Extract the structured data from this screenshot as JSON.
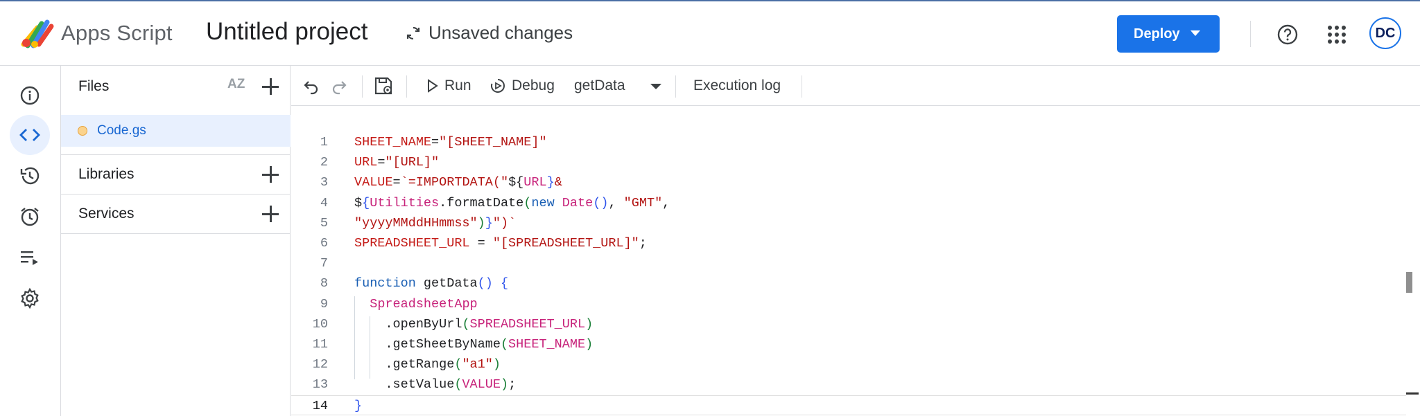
{
  "header": {
    "brand": "Apps Script",
    "project_title": "Untitled project",
    "status": "Unsaved changes",
    "deploy_label": "Deploy",
    "avatar_initials": "DC"
  },
  "rail": {
    "items": [
      {
        "icon": "info-icon",
        "label": "Overview"
      },
      {
        "icon": "code-icon",
        "label": "Editor",
        "active": true
      },
      {
        "icon": "history-icon",
        "label": "Project History"
      },
      {
        "icon": "alarm-icon",
        "label": "Triggers"
      },
      {
        "icon": "executions-icon",
        "label": "Executions"
      },
      {
        "icon": "gear-icon",
        "label": "Project Settings"
      }
    ]
  },
  "files_panel": {
    "title": "Files",
    "sort_label": "AZ",
    "files": [
      {
        "name": "Code.gs"
      }
    ],
    "sections": [
      {
        "label": "Libraries"
      },
      {
        "label": "Services"
      }
    ]
  },
  "toolbar": {
    "run_label": "Run",
    "debug_label": "Debug",
    "function_select": "getData",
    "execution_log_label": "Execution log"
  },
  "editor": {
    "current_line": 14,
    "lines": [
      {
        "n": "1",
        "tokens": [
          {
            "t": "SHEET_NAME",
            "c": "c-var"
          },
          {
            "t": "=",
            "c": "c-plain"
          },
          {
            "t": "\"[SHEET_NAME]\"",
            "c": "c-str"
          }
        ]
      },
      {
        "n": "2",
        "tokens": [
          {
            "t": "URL",
            "c": "c-var"
          },
          {
            "t": "=",
            "c": "c-plain"
          },
          {
            "t": "\"[URL]\"",
            "c": "c-str"
          }
        ]
      },
      {
        "n": "3",
        "tokens": [
          {
            "t": "VALUE",
            "c": "c-var"
          },
          {
            "t": "=",
            "c": "c-plain"
          },
          {
            "t": "`=IMPORTDATA(\"",
            "c": "c-str"
          },
          {
            "t": "${",
            "c": "c-plain"
          },
          {
            "t": "URL",
            "c": "c-pink"
          },
          {
            "t": "}",
            "c": "c-br2"
          },
          {
            "t": "&",
            "c": "c-str"
          }
        ]
      },
      {
        "n": "4",
        "tokens": [
          {
            "t": "$",
            "c": "c-plain"
          },
          {
            "t": "{",
            "c": "c-br2"
          },
          {
            "t": "Utilities",
            "c": "c-pink"
          },
          {
            "t": ".formatDate",
            "c": "c-plain"
          },
          {
            "t": "(",
            "c": "c-br"
          },
          {
            "t": "new ",
            "c": "c-kw"
          },
          {
            "t": "Date",
            "c": "c-pink"
          },
          {
            "t": "()",
            "c": "c-br2"
          },
          {
            "t": ", ",
            "c": "c-plain"
          },
          {
            "t": "\"GMT\"",
            "c": "c-str"
          },
          {
            "t": ",",
            "c": "c-plain"
          }
        ]
      },
      {
        "n": "5",
        "tokens": [
          {
            "t": "\"yyyyMMddHHmmss\"",
            "c": "c-str"
          },
          {
            "t": ")",
            "c": "c-br"
          },
          {
            "t": "}",
            "c": "c-br2"
          },
          {
            "t": "\")`",
            "c": "c-str"
          }
        ]
      },
      {
        "n": "6",
        "tokens": [
          {
            "t": "SPREADSHEET_URL",
            "c": "c-var"
          },
          {
            "t": " = ",
            "c": "c-plain"
          },
          {
            "t": "\"[SPREADSHEET_URL]\"",
            "c": "c-str"
          },
          {
            "t": ";",
            "c": "c-plain"
          }
        ]
      },
      {
        "n": "7",
        "tokens": []
      },
      {
        "n": "8",
        "tokens": [
          {
            "t": "function ",
            "c": "c-kw"
          },
          {
            "t": "getData",
            "c": "c-plain"
          },
          {
            "t": "() {",
            "c": "c-br2"
          }
        ]
      },
      {
        "n": "9",
        "tokens": [
          {
            "t": "  ",
            "c": "c-plain"
          },
          {
            "t": "SpreadsheetApp",
            "c": "c-pink"
          }
        ]
      },
      {
        "n": "10",
        "tokens": [
          {
            "t": "    .openByUrl",
            "c": "c-plain"
          },
          {
            "t": "(",
            "c": "c-br"
          },
          {
            "t": "SPREADSHEET_URL",
            "c": "c-pink"
          },
          {
            "t": ")",
            "c": "c-br"
          }
        ]
      },
      {
        "n": "11",
        "tokens": [
          {
            "t": "    .getSheetByName",
            "c": "c-plain"
          },
          {
            "t": "(",
            "c": "c-br"
          },
          {
            "t": "SHEET_NAME",
            "c": "c-pink"
          },
          {
            "t": ")",
            "c": "c-br"
          }
        ]
      },
      {
        "n": "12",
        "tokens": [
          {
            "t": "    .getRange",
            "c": "c-plain"
          },
          {
            "t": "(",
            "c": "c-br"
          },
          {
            "t": "\"a1\"",
            "c": "c-str"
          },
          {
            "t": ")",
            "c": "c-br"
          }
        ]
      },
      {
        "n": "13",
        "tokens": [
          {
            "t": "    .setValue",
            "c": "c-plain"
          },
          {
            "t": "(",
            "c": "c-br"
          },
          {
            "t": "VALUE",
            "c": "c-pink"
          },
          {
            "t": ")",
            "c": "c-br"
          },
          {
            "t": ";",
            "c": "c-plain"
          }
        ]
      },
      {
        "n": "14",
        "tokens": [
          {
            "t": "}",
            "c": "c-br2"
          }
        ]
      }
    ]
  },
  "colors": {
    "accent": "#1a73e8",
    "selection": "#e8f0fe",
    "border": "#dadce0"
  }
}
